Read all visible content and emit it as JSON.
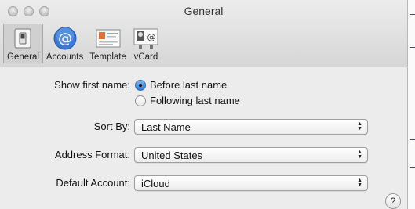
{
  "window": {
    "title": "General"
  },
  "toolbar": {
    "items": [
      {
        "label": "General",
        "icon": "general-switch-icon",
        "selected": true
      },
      {
        "label": "Accounts",
        "icon": "at-sign-icon",
        "selected": false
      },
      {
        "label": "Template",
        "icon": "template-card-icon",
        "selected": false
      },
      {
        "label": "vCard",
        "icon": "vcard-icon",
        "selected": false
      }
    ]
  },
  "settings": {
    "show_first_name": {
      "label": "Show first name:",
      "options": [
        "Before last name",
        "Following last name"
      ],
      "selected_index": 0
    },
    "sort_by": {
      "label": "Sort By:",
      "value": "Last Name"
    },
    "address_format": {
      "label": "Address Format:",
      "value": "United States"
    },
    "default_account": {
      "label": "Default Account:",
      "value": "iCloud"
    }
  },
  "help": {
    "glyph": "?"
  },
  "colors": {
    "radio_selected": "#2f7ad6",
    "accent_blue": "#3a78d8"
  }
}
